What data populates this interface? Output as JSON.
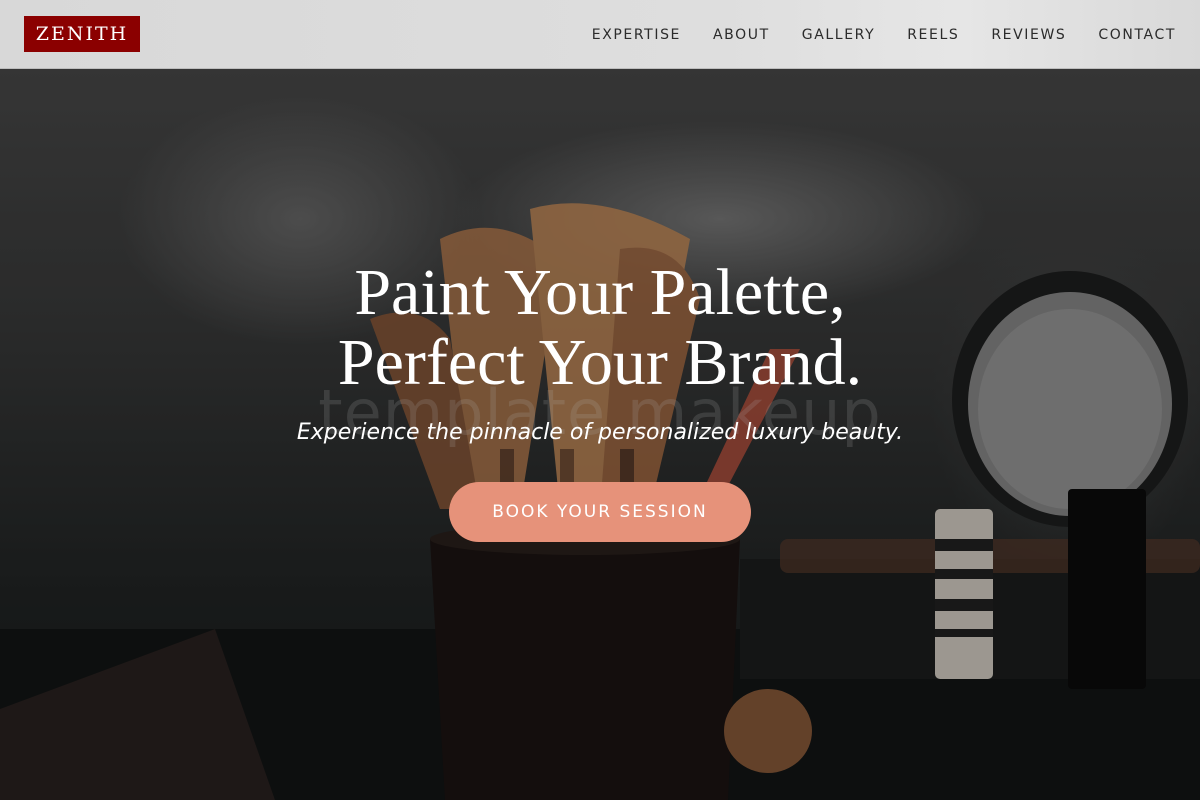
{
  "brand": {
    "name": "ZENITH",
    "color": "#8b0000"
  },
  "nav": {
    "items": [
      {
        "label": "EXPERTISE"
      },
      {
        "label": "ABOUT"
      },
      {
        "label": "GALLERY"
      },
      {
        "label": "REELS"
      },
      {
        "label": "REVIEWS"
      },
      {
        "label": "CONTACT"
      }
    ]
  },
  "hero": {
    "headline_line1": "Paint Your Palette,",
    "headline_line2": "Perfect Your Brand.",
    "watermark": "template makeup",
    "tagline": "Experience the pinnacle of personalized luxury beauty.",
    "cta_label": "BOOK YOUR SESSION",
    "cta_color": "#e6927a"
  }
}
